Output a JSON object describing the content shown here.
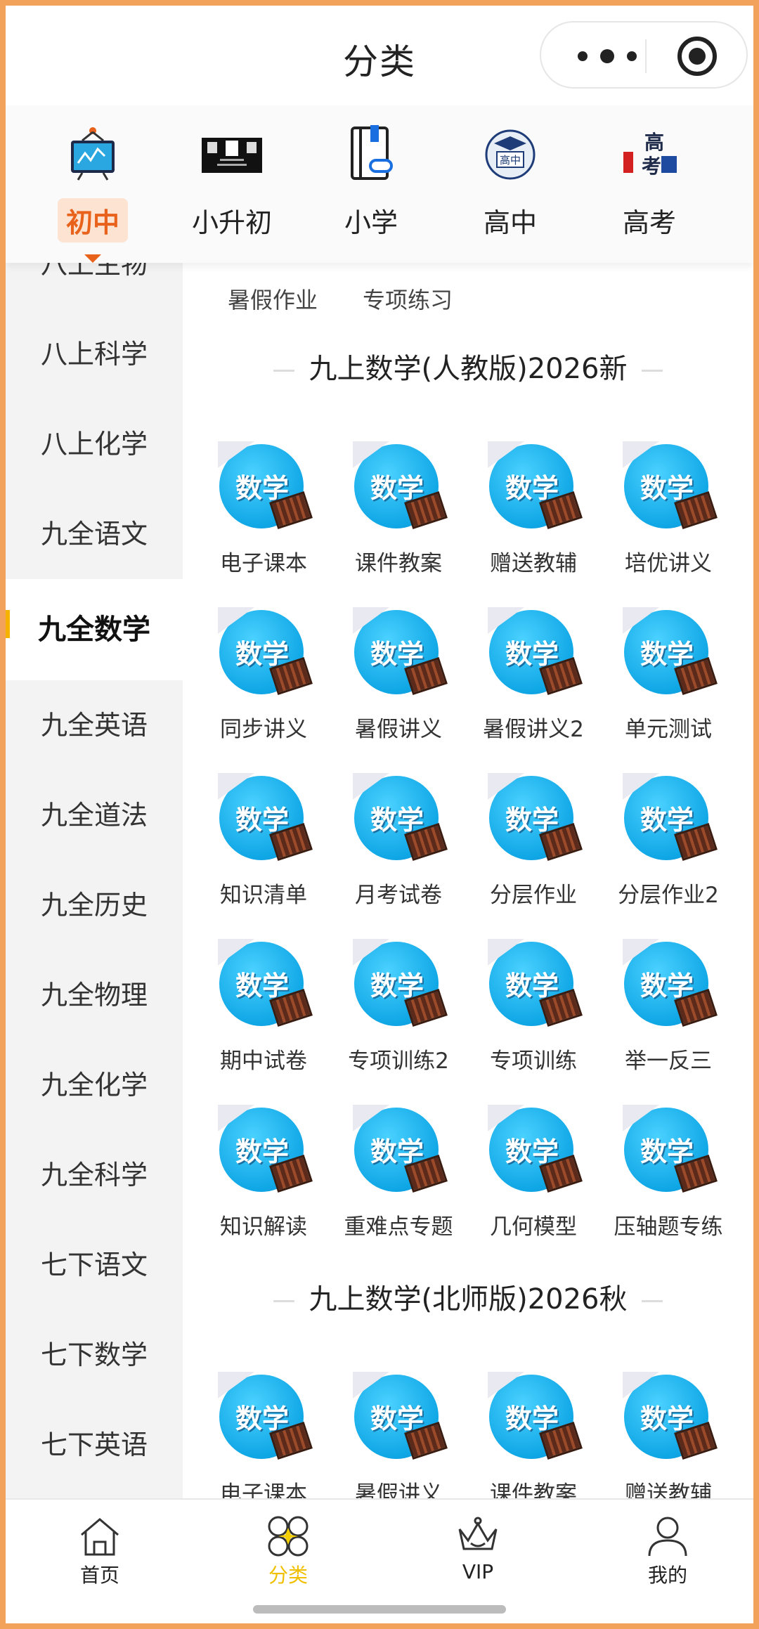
{
  "header": {
    "title": "分类"
  },
  "top_categories": [
    {
      "label": "初中",
      "icon": "board-icon",
      "active": true
    },
    {
      "label": "小升初",
      "icon": "poster-icon",
      "active": false
    },
    {
      "label": "小学",
      "icon": "book-link-icon",
      "active": false
    },
    {
      "label": "高中",
      "icon": "graduation-cap-icon",
      "active": false
    },
    {
      "label": "高考",
      "icon": "gaokao-icon",
      "active": false
    }
  ],
  "sidebar": {
    "items": [
      {
        "label": "八上生物"
      },
      {
        "label": "八上科学"
      },
      {
        "label": "八上化学"
      },
      {
        "label": "九全语文"
      },
      {
        "label": "九全数学",
        "active": true
      },
      {
        "label": "九全英语"
      },
      {
        "label": "九全道法"
      },
      {
        "label": "九全历史"
      },
      {
        "label": "九全物理"
      },
      {
        "label": "九全化学"
      },
      {
        "label": "九全科学"
      },
      {
        "label": "七下语文"
      },
      {
        "label": "七下数学"
      },
      {
        "label": "七下英语"
      }
    ]
  },
  "content": {
    "chips": [
      "暑假作业",
      "专项练习"
    ],
    "math_badge": "数学",
    "sections": [
      {
        "title": "九上数学(人教版)2026新",
        "items": [
          "电子课本",
          "课件教案",
          "赠送教辅",
          "培优讲义",
          "同步讲义",
          "暑假讲义",
          "暑假讲义2",
          "单元测试",
          "知识清单",
          "月考试卷",
          "分层作业",
          "分层作业2",
          "期中试卷",
          "专项训练2",
          "专项训练",
          "举一反三",
          "知识解读",
          "重难点专题",
          "几何模型",
          "压轴题专练"
        ]
      },
      {
        "title": "九上数学(北师版)2026秋",
        "items": [
          "电子课本",
          "暑假讲义",
          "课件教案",
          "赠送教辅"
        ]
      }
    ]
  },
  "tabbar": {
    "tabs": [
      {
        "label": "首页",
        "icon": "home-icon"
      },
      {
        "label": "分类",
        "icon": "category-icon",
        "active": true
      },
      {
        "label": "VIP",
        "icon": "crown-icon"
      },
      {
        "label": "我的",
        "icon": "user-icon"
      }
    ]
  },
  "colors": {
    "accent_orange": "#e8621c",
    "tab_active": "#f0c000",
    "sidebar_bg": "#f3f3f3"
  }
}
